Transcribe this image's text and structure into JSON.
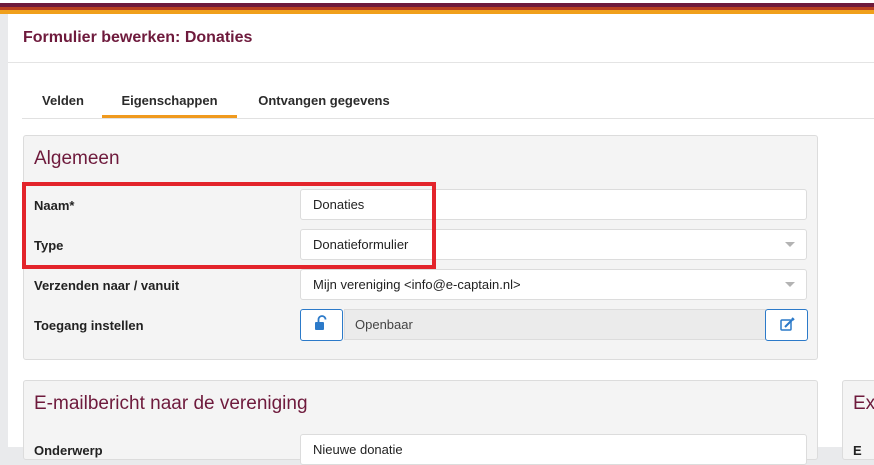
{
  "page": {
    "title": "Formulier bewerken: Donaties"
  },
  "tabs": [
    {
      "label": "Velden",
      "active": false
    },
    {
      "label": "Eigenschappen",
      "active": true
    },
    {
      "label": "Ontvangen gegevens",
      "active": false
    }
  ],
  "general": {
    "title": "Algemeen",
    "name_label": "Naam*",
    "name_value": "Donaties",
    "type_label": "Type",
    "type_value": "Donatieformulier",
    "send_label": "Verzenden naar / vanuit",
    "send_value": "Mijn vereniging <info@e-captain.nl>",
    "access_label": "Toegang instellen",
    "access_value": "Openbaar"
  },
  "email_panel": {
    "title": "E-mailbericht naar de vereniging",
    "first_label": "Onderwerp",
    "first_value": "Nieuwe donatie"
  },
  "extra_panel": {
    "title": "Ex",
    "first_label": "E"
  },
  "icons": {
    "lock": "unlock-icon",
    "edit": "edit-icon",
    "select_caret": "caret-down-icon"
  },
  "colors": {
    "title": "#6e1a3c",
    "tab_underline": "#f09a1e",
    "button_border": "#2c7ac9",
    "highlight": "#e3242b"
  }
}
